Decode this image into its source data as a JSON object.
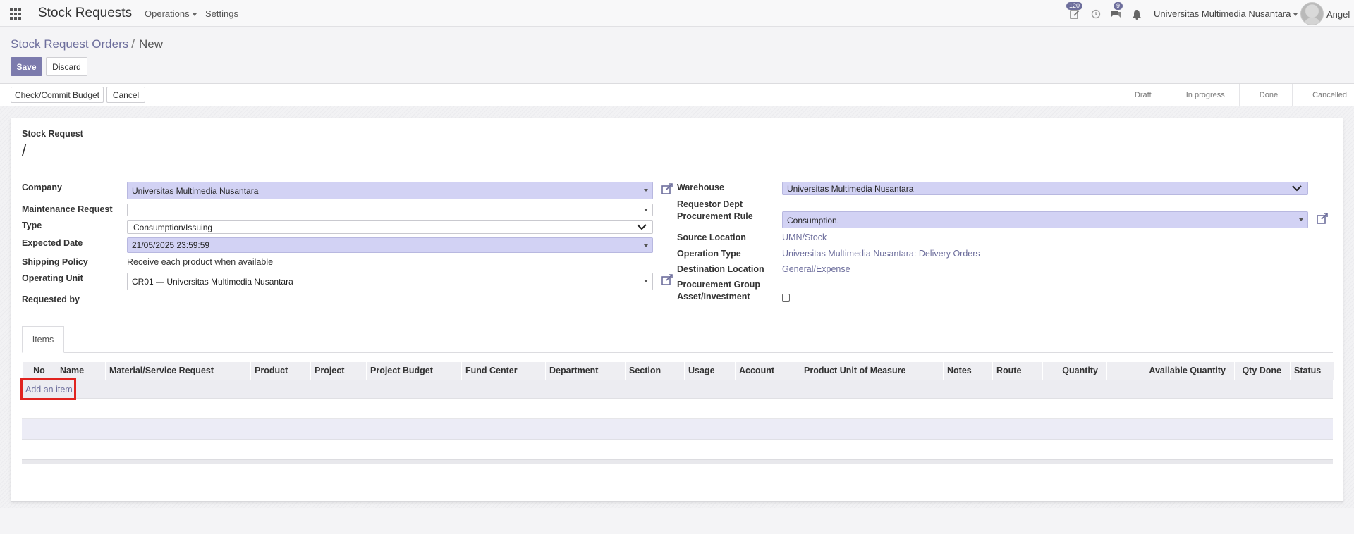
{
  "navbar": {
    "app_title": "Stock Requests",
    "menu": [
      {
        "label": "Operations",
        "has_caret": true
      },
      {
        "label": "Settings",
        "has_caret": false
      }
    ],
    "activity_badge": "120",
    "messages_badge": "9",
    "company": "Universitas Multimedia Nusantara",
    "user": "Angel",
    "icons": [
      "apps-grid-icon",
      "edit-activity-icon",
      "clock-icon",
      "chat-icon",
      "bell-icon"
    ]
  },
  "breadcrumb": {
    "parent": "Stock Request Orders",
    "separator": "/",
    "current": "New"
  },
  "buttons": {
    "save": "Save",
    "discard": "Discard",
    "check_budget": "Check/Commit Budget",
    "cancel": "Cancel"
  },
  "stages": [
    {
      "label": "Draft",
      "active": true
    },
    {
      "label": "In progress",
      "active": false
    },
    {
      "label": "Done",
      "active": false
    },
    {
      "label": "Cancelled",
      "active": false
    }
  ],
  "form": {
    "title_label": "Stock Request",
    "name": "/",
    "left": {
      "company_label": "Company",
      "company_value": "Universitas Multimedia Nusantara",
      "maintenance_label": "Maintenance Request",
      "maintenance_value": "",
      "type_label": "Type",
      "type_value": "Consumption/Issuing",
      "expected_date_label": "Expected Date",
      "expected_date_value": "21/05/2025 23:59:59",
      "shipping_policy_label": "Shipping Policy",
      "shipping_policy_value": "Receive each product when available",
      "operating_unit_label": "Operating Unit",
      "operating_unit_value": "CR01 — Universitas Multimedia Nusantara",
      "requested_by_label": "Requested by"
    },
    "right": {
      "warehouse_label": "Warehouse",
      "warehouse_value": "Universitas Multimedia Nusantara",
      "requestor_dept_label": "Requestor Dept",
      "procurement_rule_label": "Procurement Rule",
      "procurement_rule_value": "Consumption.",
      "source_location_label": "Source Location",
      "source_location_value": "UMN/Stock",
      "operation_type_label": "Operation Type",
      "operation_type_value": "Universitas Multimedia Nusantara: Delivery Orders",
      "destination_location_label": "Destination Location",
      "destination_location_value": "General/Expense",
      "procurement_group_label": "Procurement Group",
      "asset_investment_label": "Asset/Investment",
      "asset_investment_checked": false
    }
  },
  "notebook": {
    "tabs": [
      "Items"
    ],
    "columns": [
      "No",
      "Name",
      "Material/Service Request",
      "Product",
      "Project",
      "Project Budget",
      "Fund Center",
      "Department",
      "Section",
      "Usage",
      "Account",
      "Product Unit of Measure",
      "Notes",
      "Route",
      "Quantity",
      "Available Quantity",
      "Qty Done",
      "Status"
    ],
    "add_item_label": "Add an item"
  },
  "colors": {
    "brand": "#6d6e9c",
    "primary_button": "#7c7bad",
    "required_field": "#d2d2f4",
    "highlight_box": "#e0231f"
  }
}
